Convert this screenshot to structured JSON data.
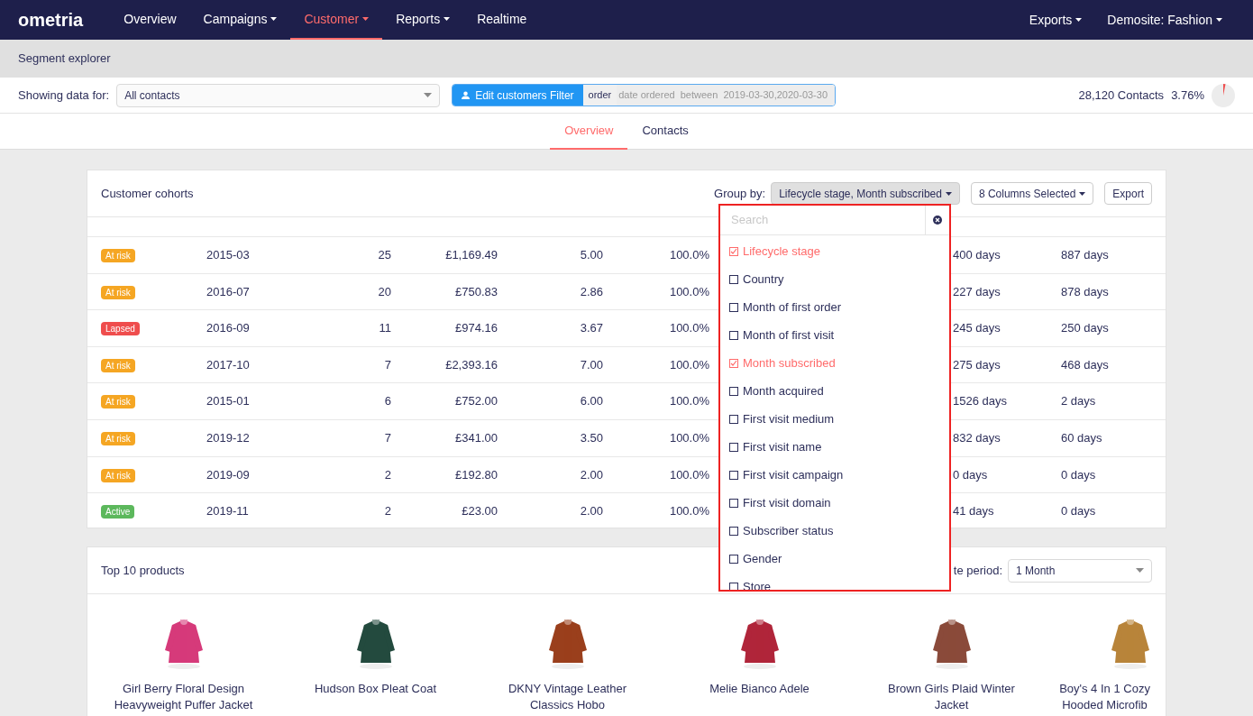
{
  "nav": {
    "logo": "ometria",
    "items": [
      {
        "label": "Overview",
        "selected": false,
        "menu": false
      },
      {
        "label": "Campaigns",
        "selected": false,
        "menu": true
      },
      {
        "label": "Customer",
        "selected": true,
        "menu": true
      },
      {
        "label": "Reports",
        "selected": false,
        "menu": true
      },
      {
        "label": "Realtime",
        "selected": false,
        "menu": false
      }
    ],
    "right_items": [
      {
        "label": "Exports",
        "menu": true
      },
      {
        "label": "Demosite: Fashion",
        "menu": true
      }
    ]
  },
  "page_title": "Segment explorer",
  "filter_bar": {
    "label": "Showing data for:",
    "select_value": "All contacts",
    "filter_button": "Edit customers Filter",
    "filter_tag": "order",
    "filter_text": "date ordered  between  2019-03-30,2020-03-30",
    "contacts": "28,120 Contacts",
    "percent": "3.76%"
  },
  "tabs": [
    {
      "label": "Overview",
      "selected": true
    },
    {
      "label": "Contacts",
      "selected": false
    }
  ],
  "cohorts": {
    "title": "Customer cohorts",
    "group_by_label": "Group by:",
    "group_by_value": "Lifecycle stage, Month subscribed",
    "columns_button": "8 Columns Selected",
    "export_button": "Export",
    "rows": [
      {
        "status": "At risk",
        "kind": "at_risk",
        "cells": [
          "2015-03",
          "25",
          "£1,169.49",
          "5.00",
          "100.0%",
          "400 days",
          "887 days"
        ]
      },
      {
        "status": "At risk",
        "kind": "at_risk",
        "cells": [
          "2016-07",
          "20",
          "£750.83",
          "2.86",
          "100.0%",
          "227 days",
          "878 days"
        ]
      },
      {
        "status": "Lapsed",
        "kind": "lapsed",
        "cells": [
          "2016-09",
          "11",
          "£974.16",
          "3.67",
          "100.0%",
          "245 days",
          "250 days"
        ]
      },
      {
        "status": "At risk",
        "kind": "at_risk",
        "cells": [
          "2017-10",
          "7",
          "£2,393.16",
          "7.00",
          "100.0%",
          "275 days",
          "468 days"
        ]
      },
      {
        "status": "At risk",
        "kind": "at_risk",
        "cells": [
          "2015-01",
          "6",
          "£752.00",
          "6.00",
          "100.0%",
          "1526 days",
          "2 days"
        ]
      },
      {
        "status": "At risk",
        "kind": "at_risk",
        "cells": [
          "2019-12",
          "7",
          "£341.00",
          "3.50",
          "100.0%",
          "832 days",
          "60 days"
        ]
      },
      {
        "status": "At risk",
        "kind": "at_risk",
        "cells": [
          "2019-09",
          "2",
          "£192.80",
          "2.00",
          "100.0%",
          "0 days",
          "0 days"
        ]
      },
      {
        "status": "Active",
        "kind": "active",
        "cells": [
          "2019-11",
          "2",
          "£23.00",
          "2.00",
          "100.0%",
          "41 days",
          "0 days"
        ]
      }
    ],
    "dropdown": {
      "placeholder": "Search",
      "options": [
        {
          "label": "Lifecycle stage",
          "checked": true
        },
        {
          "label": "Country",
          "checked": false
        },
        {
          "label": "Month of first order",
          "checked": false
        },
        {
          "label": "Month of first visit",
          "checked": false
        },
        {
          "label": "Month subscribed",
          "checked": true
        },
        {
          "label": "Month acquired",
          "checked": false
        },
        {
          "label": "First visit medium",
          "checked": false
        },
        {
          "label": "First visit name",
          "checked": false
        },
        {
          "label": "First visit campaign",
          "checked": false
        },
        {
          "label": "First visit domain",
          "checked": false
        },
        {
          "label": "Subscriber status",
          "checked": false
        },
        {
          "label": "Gender",
          "checked": false
        },
        {
          "label": "Store",
          "checked": false
        }
      ]
    }
  },
  "products": {
    "title": "Top 10 products",
    "period_label": "te period:",
    "period_value": "1 Month",
    "items": [
      {
        "name": [
          "Girl Berry Floral Design",
          "Heavyweight Puffer Jacket"
        ],
        "kind": "picture"
      },
      {
        "name": [
          "Hudson Box Pleat Coat"
        ],
        "kind": "picture"
      },
      {
        "name": [
          "DKNY Vintage Leather",
          "Classics Hobo"
        ],
        "kind": "picture"
      },
      {
        "name": [
          "Melie Bianco Adele"
        ],
        "kind": "picture"
      },
      {
        "name": [
          "Brown Girls Plaid Winter",
          "Jacket"
        ],
        "kind": "picture"
      },
      {
        "name": [
          "Boy's 4 In 1 Cozy",
          "Hooded Microfib"
        ],
        "kind": "picture"
      }
    ]
  }
}
